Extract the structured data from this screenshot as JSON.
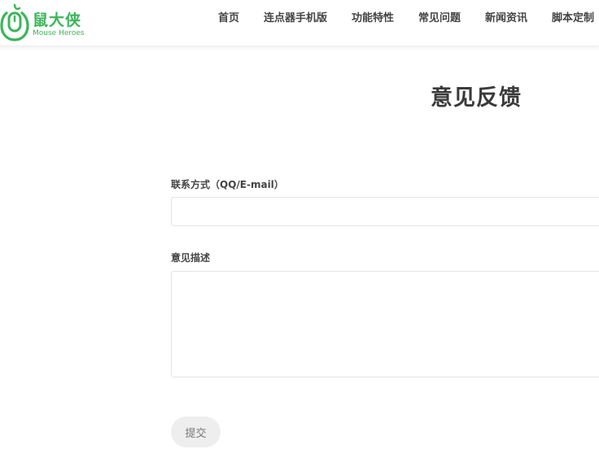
{
  "header": {
    "logo": {
      "name": "鼠大侠",
      "subtitle": "Mouse Heroes",
      "icon": "mouse-hero-logo-icon"
    },
    "nav": [
      {
        "label": "首页"
      },
      {
        "label": "连点器手机版"
      },
      {
        "label": "功能特性"
      },
      {
        "label": "常见问题"
      },
      {
        "label": "新闻资讯"
      },
      {
        "label": "脚本定制"
      }
    ]
  },
  "main": {
    "title": "意见反馈",
    "contact": {
      "label": "联系方式（QQ/E-mail）",
      "value": "",
      "placeholder": ""
    },
    "description": {
      "label": "意见描述",
      "value": "",
      "placeholder": ""
    },
    "submit_label": "提交"
  },
  "colors": {
    "brand": "#3cb55a",
    "text": "#333333",
    "input_border": "#e4e4e4",
    "button_bg": "#eeeeee"
  }
}
